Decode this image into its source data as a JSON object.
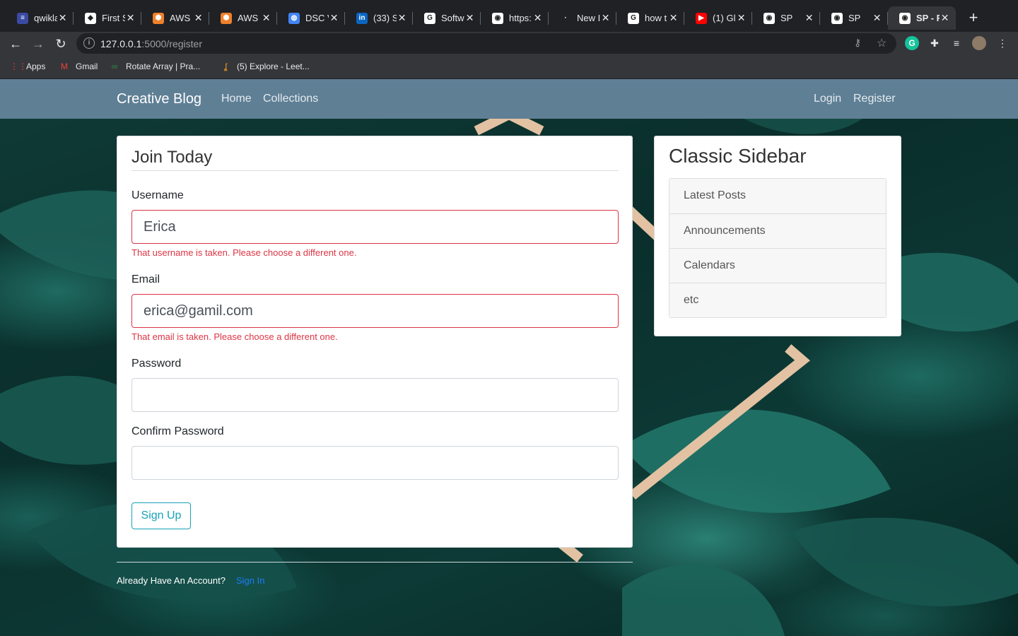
{
  "browser": {
    "tabs": [
      {
        "title": "qwikla",
        "favicon": "qwiklabs-icon",
        "color": "#3b4aa3",
        "glyph": "≡"
      },
      {
        "title": "First S",
        "favicon": "first-app-icon",
        "color": "#ffffff",
        "glyph": "◆"
      },
      {
        "title": "AWS",
        "favicon": "aws-icon",
        "color": "#f0802a",
        "glyph": "⬢"
      },
      {
        "title": "AWS",
        "favicon": "aws-icon",
        "color": "#f0802a",
        "glyph": "⬢"
      },
      {
        "title": "DSC V",
        "favicon": "dsc-icon",
        "color": "#4285f4",
        "glyph": "◍"
      },
      {
        "title": "(33) S",
        "favicon": "linkedin-icon",
        "color": "#0a66c2",
        "glyph": "in"
      },
      {
        "title": "Softw",
        "favicon": "google-icon",
        "color": "#ffffff",
        "glyph": "G"
      },
      {
        "title": "https:",
        "favicon": "globe-icon",
        "color": "#ffffff",
        "glyph": "◉"
      },
      {
        "title": "New I",
        "favicon": "new-tab-icon",
        "color": "#202124",
        "glyph": "·"
      },
      {
        "title": "how t",
        "favicon": "google-icon",
        "color": "#ffffff",
        "glyph": "G"
      },
      {
        "title": "(1) Gl",
        "favicon": "youtube-icon",
        "color": "#ff0000",
        "glyph": "▶"
      },
      {
        "title": "SP",
        "favicon": "globe-icon",
        "color": "#ffffff",
        "glyph": "◉"
      },
      {
        "title": "SP",
        "favicon": "globe-icon",
        "color": "#ffffff",
        "glyph": "◉"
      },
      {
        "title": "SP - F",
        "favicon": "globe-icon",
        "color": "#ffffff",
        "glyph": "◉"
      }
    ],
    "url_host": "127.0.0.1",
    "url_path": ":5000/register",
    "bookmarks": [
      {
        "label": "Apps",
        "icon": "apps-grid-icon",
        "glyph": "⋮⋮",
        "color": "#ea4335"
      },
      {
        "label": "Gmail",
        "icon": "gmail-icon",
        "glyph": "M",
        "color": "#ea4335"
      },
      {
        "label": "Rotate Array | Pra...",
        "icon": "gfg-icon",
        "glyph": "∞",
        "color": "#2f8d46"
      },
      {
        "label": "(5) Explore - Leet...",
        "icon": "leetcode-icon",
        "glyph": "ʆ",
        "color": "#f89f1b"
      }
    ]
  },
  "nav": {
    "brand": "Creative Blog",
    "links": [
      "Home",
      "Collections"
    ],
    "right_links": [
      "Login",
      "Register"
    ]
  },
  "form": {
    "legend": "Join Today",
    "username": {
      "label": "Username",
      "value": "Erica",
      "error": "That username is taken. Please choose a different one."
    },
    "email": {
      "label": "Email",
      "value": "erica@gamil.com",
      "error": "That email is taken. Please choose a different one."
    },
    "password": {
      "label": "Password",
      "value": ""
    },
    "confirm_password": {
      "label": "Confirm Password",
      "value": ""
    },
    "submit": "Sign Up"
  },
  "sidebar": {
    "title": "Classic Sidebar",
    "items": [
      "Latest Posts",
      "Announcements",
      "Calendars",
      "etc"
    ]
  },
  "footer": {
    "text": "Already Have An Account?",
    "link": "Sign In"
  },
  "colors": {
    "navbar": "#5f7f95",
    "error": "#dc3545",
    "accent_button": "#17a2b8",
    "link": "#1e7cf5"
  }
}
